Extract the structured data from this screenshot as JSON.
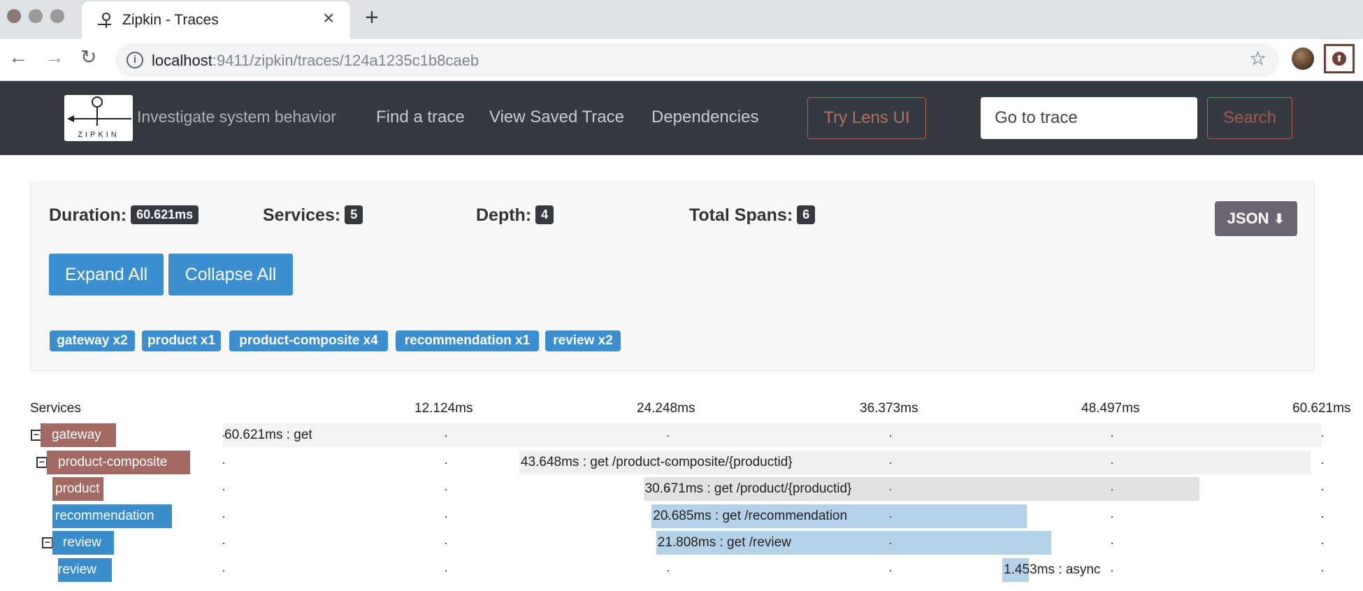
{
  "browser": {
    "tab_title": "Zipkin - Traces",
    "url_host": "localhost",
    "url_rest": ":9411/zipkin/traces/124a1235c1b8caeb"
  },
  "header": {
    "logo_text": "ZIPKIN",
    "tagline": "Investigate system behavior",
    "nav": [
      "Find a trace",
      "View Saved Trace",
      "Dependencies"
    ],
    "lens_button": "Try Lens UI",
    "goto_placeholder": "Go to trace",
    "search_button": "Search"
  },
  "summary": {
    "duration_label": "Duration:",
    "duration_value": "60.621ms",
    "services_label": "Services:",
    "services_value": "5",
    "depth_label": "Depth:",
    "depth_value": "4",
    "total_spans_label": "Total Spans:",
    "total_spans_value": "6",
    "json_button": "JSON",
    "expand_all": "Expand All",
    "collapse_all": "Collapse All",
    "service_badges": [
      "gateway x2",
      "product x1",
      "product-composite x4",
      "recommendation x1",
      "review x2"
    ]
  },
  "timeline": {
    "services_header": "Services",
    "ticks": [
      "12.124ms",
      "24.248ms",
      "36.373ms",
      "48.497ms",
      "60.621ms"
    ],
    "total_ms": 60.621,
    "rows": [
      {
        "service": "gateway",
        "label": "60.621ms : get",
        "start_ms": 0,
        "duration_ms": 60.621,
        "color": "brown",
        "toggle": true
      },
      {
        "service": "product-composite",
        "label": "43.648ms : get /product-composite/{productid}",
        "start_ms": 16.35,
        "duration_ms": 43.648,
        "color": "brown",
        "toggle": true
      },
      {
        "service": "product",
        "label": "30.671ms : get /product/{productid}",
        "start_ms": 23.2,
        "duration_ms": 30.671,
        "color": "brown",
        "toggle": false
      },
      {
        "service": "recommendation",
        "label": "20.685ms : get /recommendation",
        "start_ms": 23.65,
        "duration_ms": 20.685,
        "color": "blue",
        "toggle": false
      },
      {
        "service": "review",
        "label": "21.808ms : get /review",
        "start_ms": 23.9,
        "duration_ms": 21.808,
        "color": "blue",
        "toggle": true
      },
      {
        "service": "review",
        "label": "1.453ms : async",
        "start_ms": 43.0,
        "duration_ms": 1.453,
        "color": "blue",
        "toggle": false
      }
    ]
  },
  "colors": {
    "header_bg": "#343a40",
    "primary": "#3b8fd0",
    "service_brown": "#a36a63",
    "service_blue": "#3a8ccb"
  }
}
